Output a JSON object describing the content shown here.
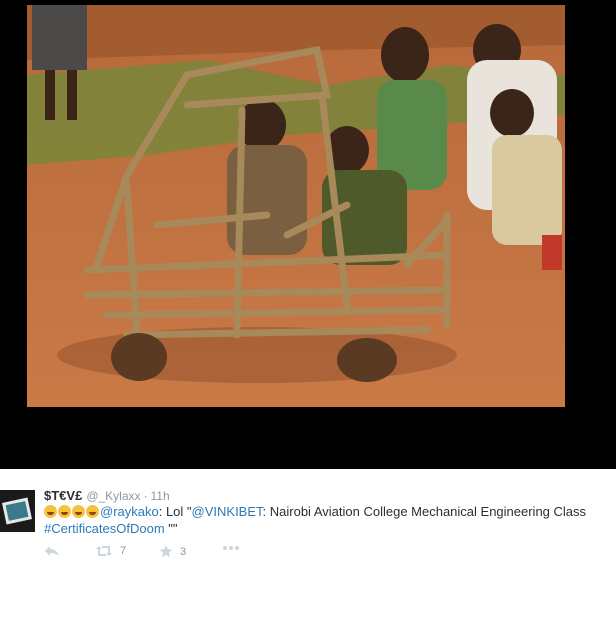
{
  "tweet": {
    "display_name": "$T€V£",
    "handle": "@_Kylaxx",
    "separator": "·",
    "time": "11h",
    "emoji": [
      "face-with-tears-of-joy",
      "face-with-tears-of-joy",
      "face-with-tears-of-joy",
      "face-with-tears-of-joy"
    ],
    "mention_1": "@raykako",
    "text_1": ": Lol \"",
    "mention_2": "@VINKIBET",
    "text_2": ": Nairobi Aviation College Mechanical Engineering Class",
    "hashtag": "#CertificatesOfDoom",
    "text_3": " \"\"",
    "retweet_count": "7",
    "favorite_count": "3"
  },
  "icons": {
    "reply": "reply-icon",
    "retweet": "retweet-icon",
    "favorite": "star-icon",
    "more": "more-icon"
  },
  "colors": {
    "link": "#2b7bb9",
    "meta": "#8899a6",
    "text": "#292f33",
    "media_bg": "#000000"
  }
}
